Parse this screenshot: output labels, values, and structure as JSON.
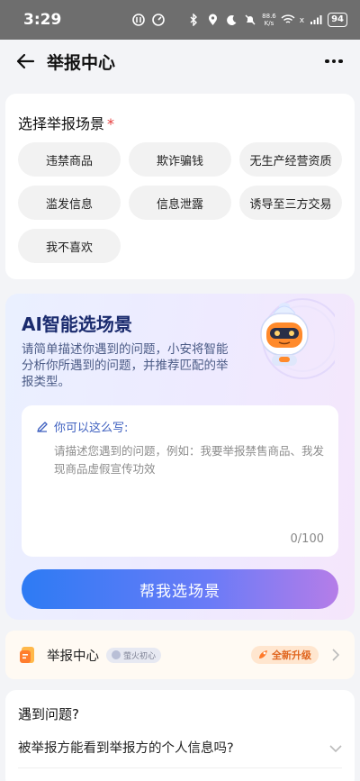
{
  "status_bar": {
    "time": "3:29",
    "network_speed_value": "88.6",
    "network_speed_unit": "K/s",
    "signal_label": "x",
    "battery": "94"
  },
  "nav": {
    "title": "举报中心"
  },
  "scene": {
    "title": "选择举报场景",
    "required_mark": "*",
    "tags": [
      "违禁商品",
      "欺诈骗钱",
      "无生产经营资质",
      "滥发信息",
      "信息泄露",
      "诱导至三方交易",
      "我不喜欢"
    ]
  },
  "ai": {
    "title": "AI智能选场景",
    "description": "请简单描述你遇到的问题，小安将智能分析你所遇到的问题，并推荐匹配的举报类型。",
    "hint_label": "你可以这么写:",
    "placeholder": "请描述您遇到的问题，例如：我要举报禁售商品、我发现商品虚假宣传功效",
    "counter": "0/100",
    "button_label": "帮我选场景"
  },
  "center": {
    "title": "举报中心",
    "badge": "萤火初心",
    "upgrade": "全新升级"
  },
  "faq": {
    "title": "遇到问题?",
    "question": "被举报方能看到举报方的个人信息吗?"
  },
  "colors": {
    "accent_blue": "#2d7bf4",
    "accent_purple": "#b57de8",
    "required_red": "#e53a3a",
    "upgrade_orange": "#e0661f"
  }
}
